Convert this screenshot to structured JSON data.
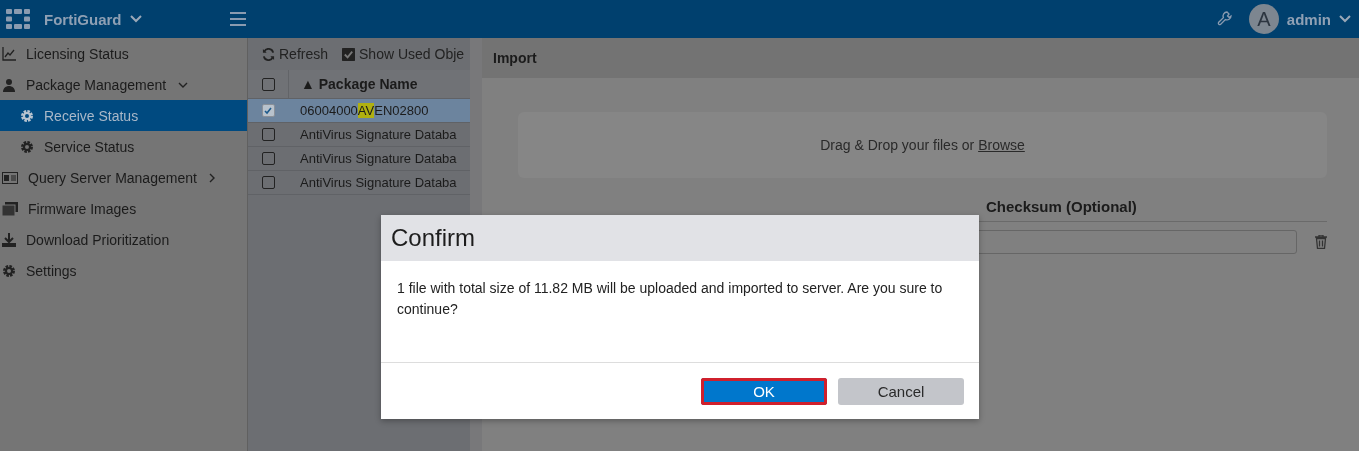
{
  "topbar": {
    "brand": "FortiGuard",
    "user_initial": "A",
    "user": "admin"
  },
  "sidebar": {
    "items": [
      {
        "label": "Licensing Status",
        "selected": false
      },
      {
        "label": "Package Management",
        "selected": false,
        "expanded": true,
        "children": [
          {
            "label": "Receive Status",
            "selected": true
          },
          {
            "label": "Service Status",
            "selected": false
          }
        ]
      },
      {
        "label": "Query Server Management",
        "selected": false,
        "expanded": false
      },
      {
        "label": "Firmware Images",
        "selected": false
      },
      {
        "label": "Download Prioritization",
        "selected": false
      },
      {
        "label": "Settings",
        "selected": false
      }
    ]
  },
  "toolbar": {
    "refresh": "Refresh",
    "show_used": "Show Used Obje",
    "show_used_checked": true
  },
  "table": {
    "select_all_checked": false,
    "columns": [
      "▲ Package Name"
    ],
    "rows": [
      {
        "name_parts": [
          "06004000",
          "AV",
          "EN02800"
        ],
        "selected": true
      },
      {
        "name_parts": [
          "AntiVirus Signature Databa"
        ],
        "selected": false
      },
      {
        "name_parts": [
          "AntiVirus Signature Databa"
        ],
        "selected": false
      },
      {
        "name_parts": [
          "AntiVirus Signature Databa"
        ],
        "selected": false
      }
    ]
  },
  "import": {
    "title": "Import",
    "drop_text": "Drag & Drop your files or ",
    "browse": "Browse",
    "checksum_heading": "Checksum (Optional)"
  },
  "dialog": {
    "title": "Confirm",
    "message": "1 file with total size of 11.82 MB will be uploaded and imported to server. Are you sure to continue?",
    "buttons": [
      {
        "label": "OK",
        "kind": "primary",
        "focused": true
      },
      {
        "label": "Cancel",
        "kind": "secondary",
        "focused": false
      }
    ]
  }
}
